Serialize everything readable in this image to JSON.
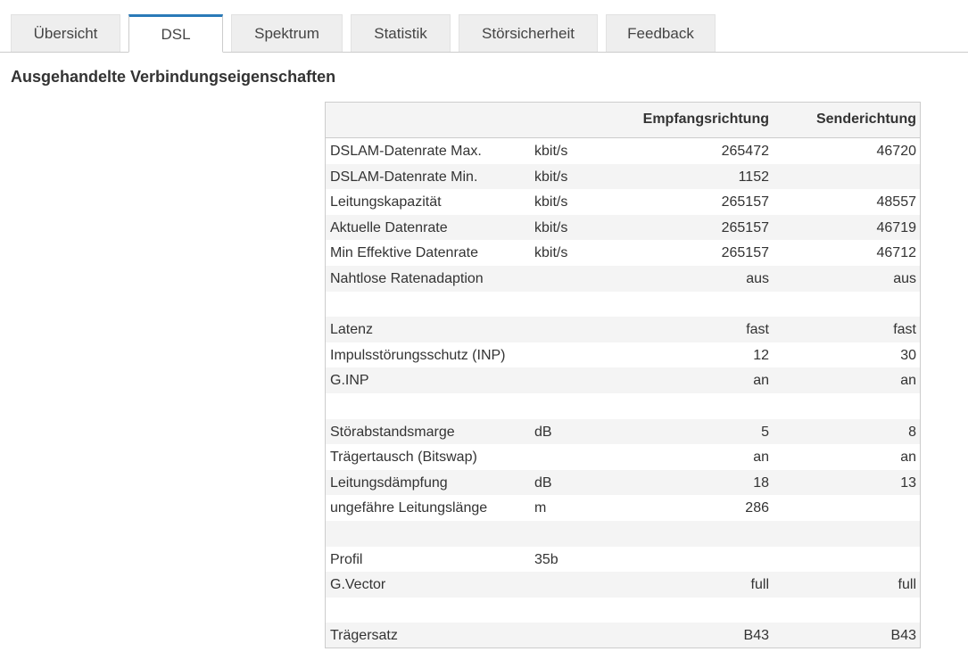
{
  "tabs": [
    {
      "label": "Übersicht"
    },
    {
      "label": "DSL"
    },
    {
      "label": "Spektrum"
    },
    {
      "label": "Statistik"
    },
    {
      "label": "Störsicherheit"
    },
    {
      "label": "Feedback"
    }
  ],
  "active_tab": "DSL",
  "section_title": "Ausgehandelte Verbindungseigenschaften",
  "table": {
    "headers": {
      "label": "",
      "unit": "",
      "receive": "Empfangsrichtung",
      "send": "Senderichtung"
    },
    "rows": [
      {
        "label": "DSLAM-Datenrate Max.",
        "unit": "kbit/s",
        "receive": "265472",
        "send": "46720"
      },
      {
        "label": "DSLAM-Datenrate Min.",
        "unit": "kbit/s",
        "receive": "1152",
        "send": ""
      },
      {
        "label": "Leitungskapazität",
        "unit": "kbit/s",
        "receive": "265157",
        "send": "48557"
      },
      {
        "label": "Aktuelle Datenrate",
        "unit": "kbit/s",
        "receive": "265157",
        "send": "46719"
      },
      {
        "label": "Min Effektive Datenrate",
        "unit": "kbit/s",
        "receive": "265157",
        "send": "46712"
      },
      {
        "label": "Nahtlose Ratenadaption",
        "unit": "",
        "receive": "aus",
        "send": "aus"
      },
      {
        "label": "",
        "unit": "",
        "receive": "",
        "send": ""
      },
      {
        "label": "Latenz",
        "unit": "",
        "receive": "fast",
        "send": "fast"
      },
      {
        "label": "Impulsstörungsschutz (INP)",
        "unit": "",
        "receive": "12",
        "send": "30"
      },
      {
        "label": "G.INP",
        "unit": "",
        "receive": "an",
        "send": "an"
      },
      {
        "label": "",
        "unit": "",
        "receive": "",
        "send": ""
      },
      {
        "label": "Störabstandsmarge",
        "unit": "dB",
        "receive": "5",
        "send": "8"
      },
      {
        "label": "Trägertausch (Bitswap)",
        "unit": "",
        "receive": "an",
        "send": "an"
      },
      {
        "label": "Leitungsdämpfung",
        "unit": "dB",
        "receive": "18",
        "send": "13"
      },
      {
        "label": "ungefähre Leitungslänge",
        "unit": "m",
        "receive": "286",
        "send": ""
      },
      {
        "label": "",
        "unit": "",
        "receive": "",
        "send": ""
      },
      {
        "label": "Profil",
        "unit": "35b",
        "receive": "",
        "send": ""
      },
      {
        "label": "G.Vector",
        "unit": "",
        "receive": "full",
        "send": "full"
      },
      {
        "label": "",
        "unit": "",
        "receive": "",
        "send": ""
      },
      {
        "label": "Trägersatz",
        "unit": "",
        "receive": "B43",
        "send": "B43"
      }
    ]
  },
  "colors": {
    "active_tab_accent": "#2a7ab8",
    "tab_background": "#eeeeee",
    "row_stripe": "#f4f4f4",
    "border": "#cccccc"
  }
}
